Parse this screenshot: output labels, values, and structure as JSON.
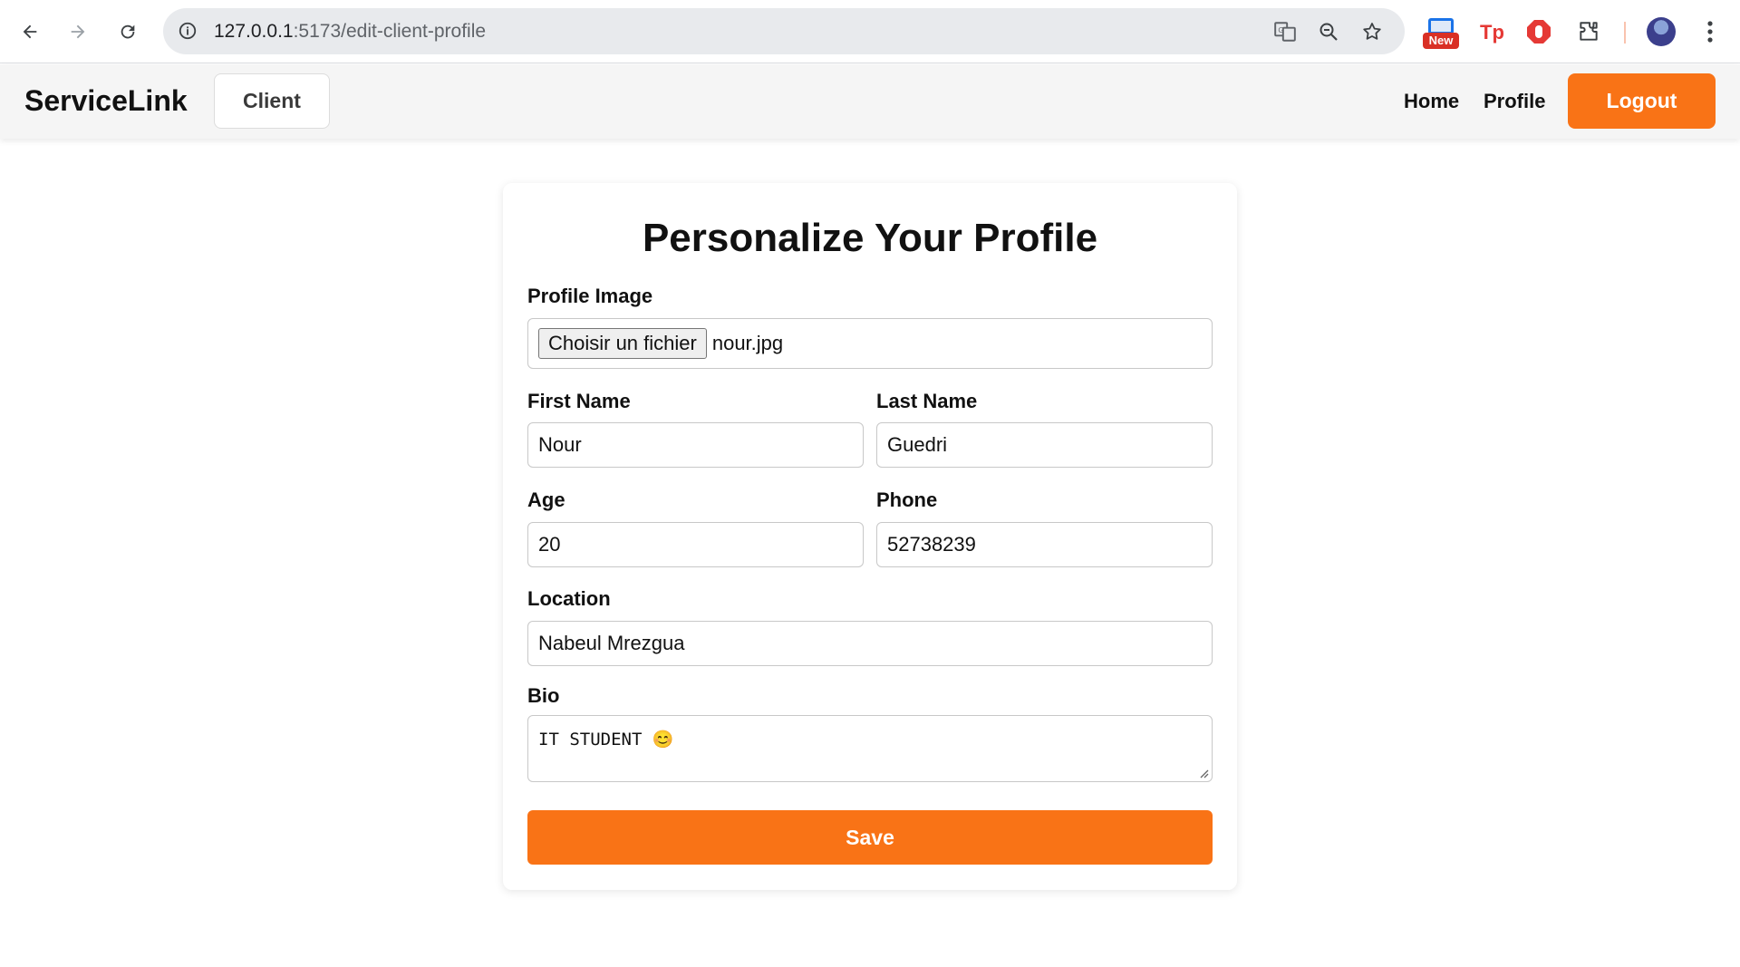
{
  "browser": {
    "url_host": "127.0.0.1",
    "url_path": ":5173/edit-client-profile",
    "new_badge": "New"
  },
  "navbar": {
    "brand": "ServiceLink",
    "role": "Client",
    "links": [
      "Home",
      "Profile"
    ],
    "logout": "Logout"
  },
  "form": {
    "title": "Personalize Your Profile",
    "profile_image_label": "Profile Image",
    "file_button": "Choisir un fichier",
    "file_name": "nour.jpg",
    "first_name_label": "First Name",
    "first_name": "Nour",
    "last_name_label": "Last Name",
    "last_name": "Guedri",
    "age_label": "Age",
    "age": "20",
    "phone_label": "Phone",
    "phone": "52738239",
    "location_label": "Location",
    "location": "Nabeul Mrezgua",
    "bio_label": "Bio",
    "bio": "IT STUDENT 😊",
    "save": "Save"
  },
  "colors": {
    "accent": "#f97316"
  }
}
